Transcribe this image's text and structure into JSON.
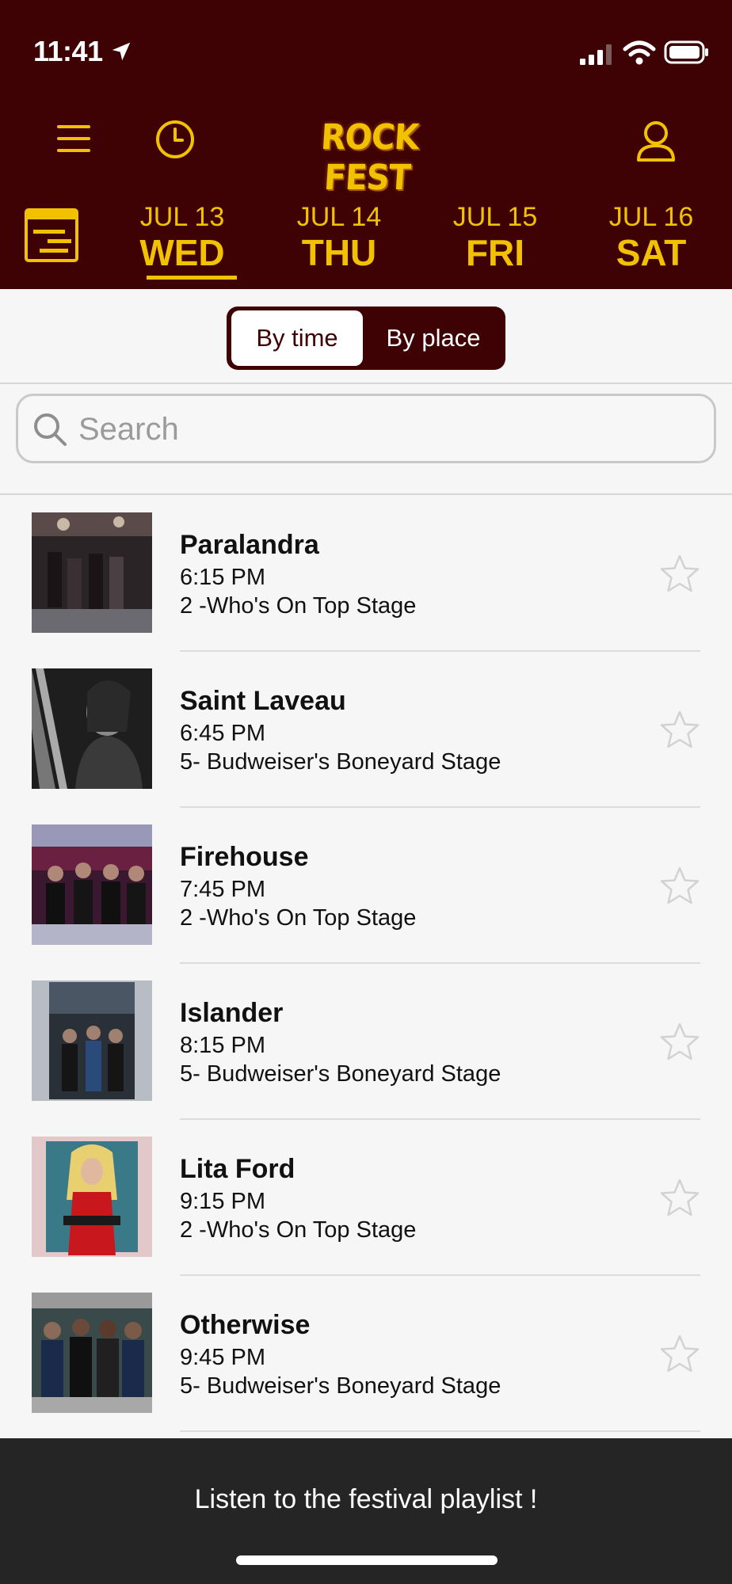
{
  "status_bar": {
    "time": "11:41"
  },
  "header": {
    "logo_text": "ROCK FEST",
    "days": [
      {
        "date": "JUL 13",
        "dow": "WED",
        "active": true
      },
      {
        "date": "JUL 14",
        "dow": "THU",
        "active": false
      },
      {
        "date": "JUL 15",
        "dow": "FRI",
        "active": false
      },
      {
        "date": "JUL 16",
        "dow": "SAT",
        "active": false
      }
    ]
  },
  "view_toggle": {
    "by_time": "By time",
    "by_place": "By place",
    "selected": "By time"
  },
  "search": {
    "placeholder": "Search",
    "value": ""
  },
  "performances": [
    {
      "name": "Paralandra",
      "time": "6:15 PM",
      "stage": "2 -Who's On Top Stage",
      "favorite": false
    },
    {
      "name": "Saint Laveau",
      "time": "6:45 PM",
      "stage": "5- Budweiser's Boneyard Stage",
      "favorite": false
    },
    {
      "name": "Firehouse",
      "time": "7:45 PM",
      "stage": "2 -Who's On Top Stage",
      "favorite": false
    },
    {
      "name": "Islander",
      "time": "8:15 PM",
      "stage": "5- Budweiser's Boneyard Stage",
      "favorite": false
    },
    {
      "name": "Lita Ford",
      "time": "9:15 PM",
      "stage": "2 -Who's On Top Stage",
      "favorite": false
    },
    {
      "name": "Otherwise",
      "time": "9:45 PM",
      "stage": "5- Budweiser's Boneyard Stage",
      "favorite": false
    }
  ],
  "bottom_bar": {
    "playlist_label": "Listen to the festival playlist !"
  },
  "colors": {
    "header_bg": "#3e0204",
    "accent": "#f2c200",
    "list_bg": "#f6f6f6",
    "bottom_bg": "#252525"
  }
}
